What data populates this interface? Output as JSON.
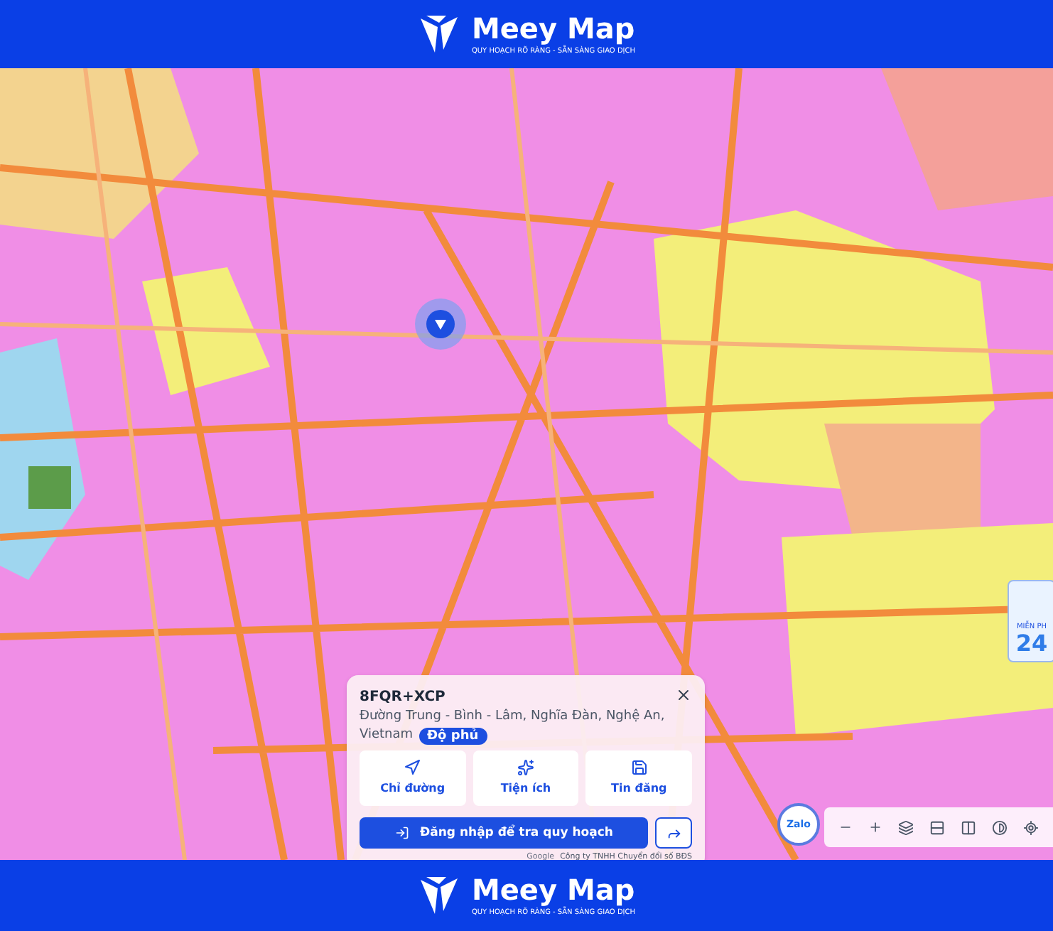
{
  "header": {
    "brand": "Meey Map",
    "tagline": "QUY HOẠCH RÕ RÀNG - SẴN SÀNG GIAO DỊCH"
  },
  "location_card": {
    "code": "8FQR+XCP",
    "address": [
      "Đường Trung - Bình - Lâm, Nghĩa Đàn, Nghệ An,",
      "Vietnam"
    ],
    "badge": "Độ phủ",
    "actions": [
      {
        "kind": "directions",
        "label": "Chỉ đường"
      },
      {
        "kind": "amenities",
        "label": "Tiện ích"
      },
      {
        "kind": "listings",
        "label": "Tin đăng"
      }
    ],
    "login_button": "Đăng nhập để tra quy hoạch"
  },
  "attribution": {
    "provider": "Google",
    "owner": "Công ty TNHH Chuyển đổi số BĐS"
  },
  "chat_button": "Zalo",
  "promo": {
    "label": "MIỄN PH",
    "number": "24"
  },
  "footer": {
    "brand": "Meey Map",
    "tagline": "QUY HOẠCH RÕ RÀNG - SẴN SÀNG GIAO DỊCH"
  }
}
